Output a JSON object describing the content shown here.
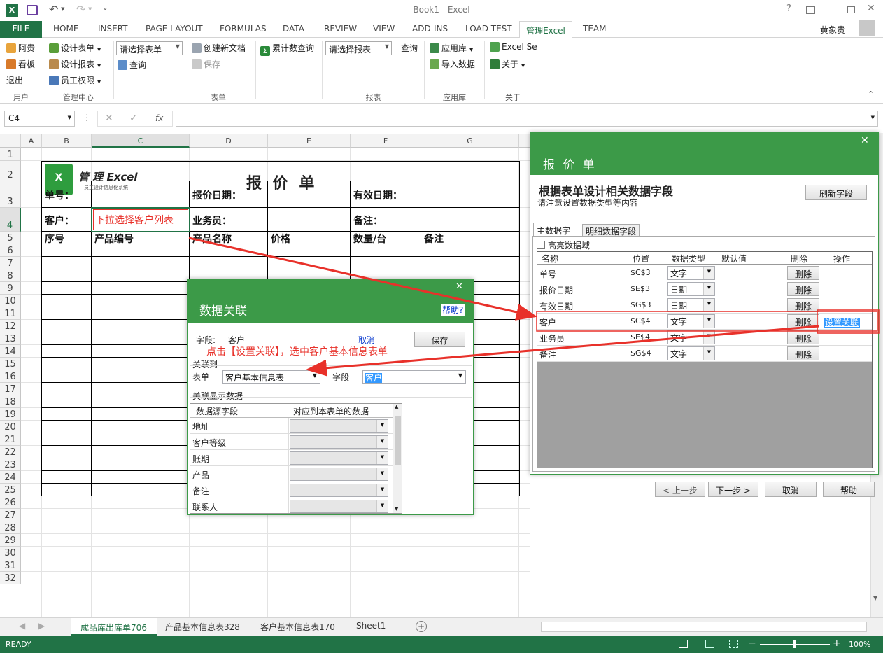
{
  "window": {
    "title": "Book1 - Excel",
    "user": "黄象贵"
  },
  "tabs": [
    "FILE",
    "HOME",
    "INSERT",
    "PAGE LAYOUT",
    "FORMULAS",
    "DATA",
    "REVIEW",
    "VIEW",
    "ADD-INS",
    "LOAD TEST",
    "管理Excel",
    "TEAM"
  ],
  "ribbon": {
    "user_items": [
      "阿贵",
      "看板",
      "退出"
    ],
    "mgmt_items": [
      "设计表单",
      "设计报表",
      "员工权限"
    ],
    "form_combo": "请选择表单",
    "form_items": [
      "创建新文档",
      "查询",
      "保存"
    ],
    "count_query": "累计数查询",
    "report_combo": "请选择报表",
    "report_query": "查询",
    "app_items": [
      "应用库",
      "导入数据"
    ],
    "about_items": [
      "Excel Se",
      "关于"
    ],
    "groups": [
      "用户",
      "管理中心",
      "表单",
      "报表",
      "应用库",
      "关于"
    ]
  },
  "formula": {
    "name_box": "C4",
    "fx": "fx"
  },
  "grid": {
    "columns": [
      "A",
      "B",
      "C",
      "D",
      "E",
      "F",
      "G"
    ],
    "rows": [
      "1",
      "2",
      "3",
      "4",
      "5",
      "6",
      "7",
      "8",
      "9",
      "10",
      "11",
      "12",
      "13",
      "14",
      "15",
      "16",
      "17",
      "18",
      "19",
      "20",
      "21",
      "22",
      "23",
      "24",
      "25",
      "26",
      "27",
      "28",
      "29",
      "30",
      "31",
      "32"
    ],
    "logo_text": "管 理 Excel",
    "logo_sub": "员工设计信息化系统",
    "title": "报 价 单",
    "labels": {
      "order_no": "单号：",
      "quote_date": "报价日期：",
      "valid_date": "有效日期：",
      "customer": "客户：",
      "salesman": "业务员：",
      "remark": "备注：",
      "seq": "序号",
      "product_code": "产品编号",
      "product_name": "产品名称",
      "price": "价格",
      "qty": "数量/台",
      "note": "备注"
    },
    "c4_hint": "下拉选择客户列表"
  },
  "panel": {
    "title": "报 价 单",
    "heading": "根据表单设计相关数据字段",
    "sub": "请注意设置数据类型等内容",
    "refresh": "刷新字段",
    "tabs": [
      "主数据字段",
      "明细数据字段"
    ],
    "highlight": "高亮数据域",
    "headers": [
      "名称",
      "位置",
      "数据类型",
      "默认值",
      "删除",
      "操作"
    ],
    "rows": [
      {
        "name": "单号",
        "pos": "$C$3",
        "type": "文字",
        "del": "删除",
        "op": ""
      },
      {
        "name": "报价日期",
        "pos": "$E$3",
        "type": "日期",
        "del": "删除",
        "op": ""
      },
      {
        "name": "有效日期",
        "pos": "$G$3",
        "type": "日期",
        "del": "删除",
        "op": ""
      },
      {
        "name": "客户",
        "pos": "$C$4",
        "type": "文字",
        "del": "删除",
        "op": "设置关联"
      },
      {
        "name": "业务员",
        "pos": "$E$4",
        "type": "文字",
        "del": "删除",
        "op": ""
      },
      {
        "name": "备注",
        "pos": "$G$4",
        "type": "文字",
        "del": "删除",
        "op": ""
      }
    ],
    "prev": "< 上一步",
    "next": "下一步 >",
    "cancel": "取消",
    "help": "帮助"
  },
  "relation": {
    "title": "数据关联",
    "help_link": "帮助?",
    "field_label": "字段:",
    "field_value": "客户",
    "cancel_link": "取消",
    "save": "保存",
    "annotation": "点击【设置关联】，选中客户基本信息表单",
    "link_to": "关联到",
    "table_label": "表单",
    "table_value": "客户基本信息表",
    "field2_label": "字段",
    "field2_value": "客户",
    "display_label": "关联显示数据",
    "col1": "数据源字段",
    "col2": "对应到本表单的数据",
    "items": [
      "地址",
      "客户等级",
      "账期",
      "产品",
      "备注",
      "联系人"
    ]
  },
  "sheets": [
    "成品库出库单706",
    "产品基本信息表328",
    "客户基本信息表170",
    "Sheet1"
  ],
  "status": {
    "ready": "READY",
    "zoom": "100%"
  },
  "colors": {
    "excel_green": "#217346",
    "panel_green": "#3c9a48",
    "annotation_red": "#e8312a"
  }
}
